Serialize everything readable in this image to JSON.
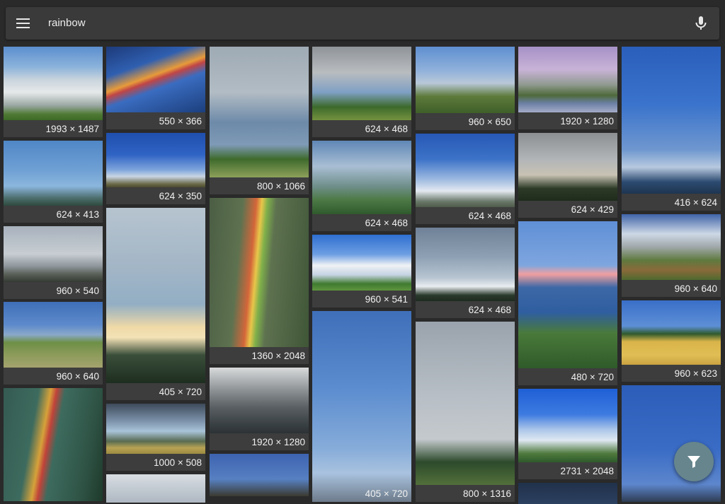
{
  "search": {
    "query": "rainbow",
    "menu_icon": "menu-icon",
    "mic_icon": "mic-icon"
  },
  "results": [
    {
      "dims": "1993 × 1487"
    },
    {
      "dims": "624 × 413"
    },
    {
      "dims": "960 × 540"
    },
    {
      "dims": "960 × 640"
    },
    {
      "dims": ""
    },
    {
      "dims": "550 × 366"
    },
    {
      "dims": "624 × 350"
    },
    {
      "dims": "405 × 720"
    },
    {
      "dims": "1000 × 508"
    },
    {
      "dims": ""
    },
    {
      "dims": "800 × 1066"
    },
    {
      "dims": "1360 × 2048"
    },
    {
      "dims": "1920 × 1280"
    },
    {
      "dims": ""
    },
    {
      "dims": "624 × 468"
    },
    {
      "dims": "624 × 468"
    },
    {
      "dims": "960 × 541"
    },
    {
      "dims": "405 × 720"
    },
    {
      "dims": "960 × 650"
    },
    {
      "dims": "624 × 468"
    },
    {
      "dims": "624 × 468"
    },
    {
      "dims": "800 × 1316"
    },
    {
      "dims": "1920 × 1280"
    },
    {
      "dims": "624 × 429"
    },
    {
      "dims": "480 × 720"
    },
    {
      "dims": "2731 × 2048"
    },
    {
      "dims": ""
    },
    {
      "dims": "416 × 624"
    },
    {
      "dims": "960 × 640"
    },
    {
      "dims": "960 × 623"
    },
    {
      "dims": ""
    }
  ],
  "fab": {
    "icon": "filter-icon"
  }
}
